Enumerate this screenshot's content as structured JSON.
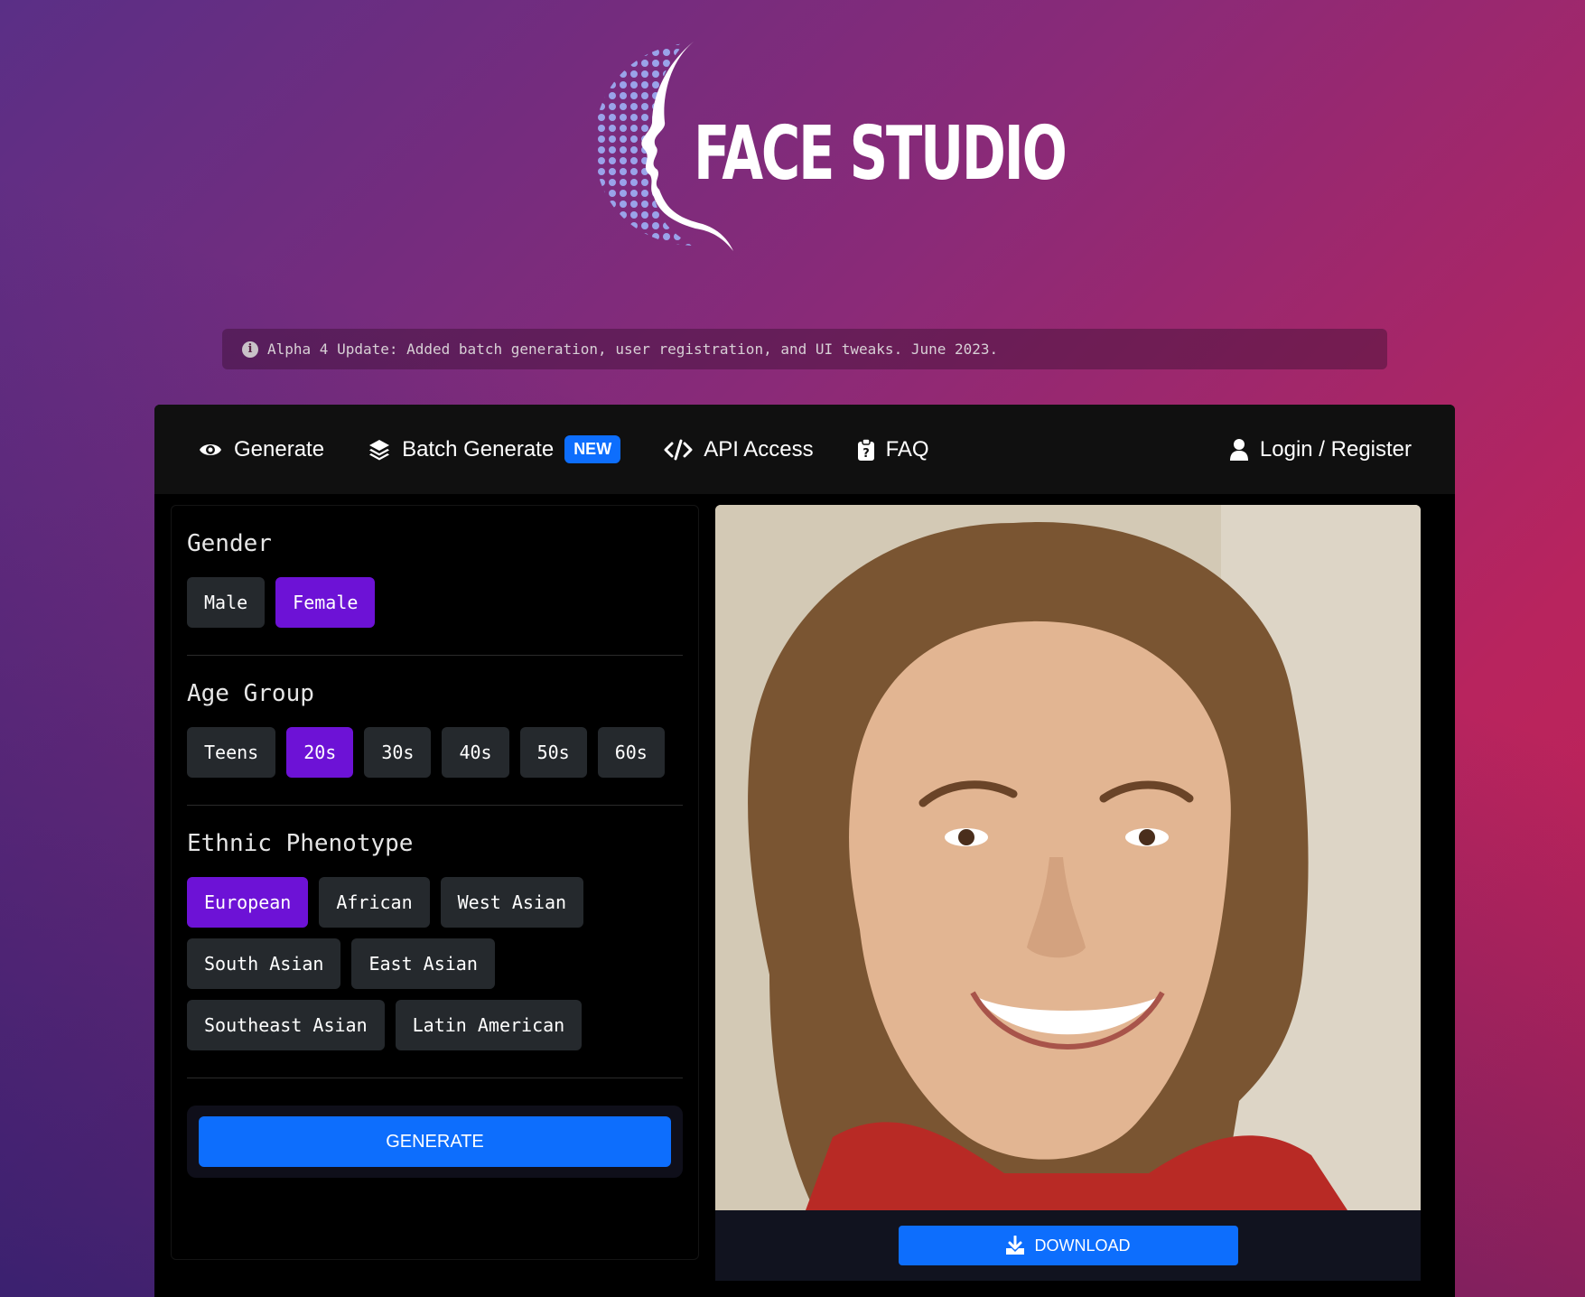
{
  "brand": {
    "name": "FACE STUDIO"
  },
  "banner": {
    "text": "Alpha 4 Update: Added batch generation, user registration, and UI tweaks. June 2023."
  },
  "nav": {
    "generate": "Generate",
    "batch": "Batch Generate",
    "batch_badge": "NEW",
    "api": "API Access",
    "faq": "FAQ",
    "login": "Login / Register"
  },
  "gender": {
    "title": "Gender",
    "options": [
      "Male",
      "Female"
    ],
    "selected": "Female"
  },
  "age": {
    "title": "Age Group",
    "options": [
      "Teens",
      "20s",
      "30s",
      "40s",
      "50s",
      "60s"
    ],
    "selected": "20s"
  },
  "ethnicity": {
    "title": "Ethnic Phenotype",
    "options": [
      "European",
      "African",
      "West Asian",
      "South Asian",
      "East Asian",
      "Southeast Asian",
      "Latin American"
    ],
    "selected": "European"
  },
  "actions": {
    "generate": "GENERATE",
    "download": "DOWNLOAD"
  },
  "colors": {
    "accent": "#0d6efd",
    "selected": "#6d12d6",
    "option_bg": "#25292d"
  }
}
